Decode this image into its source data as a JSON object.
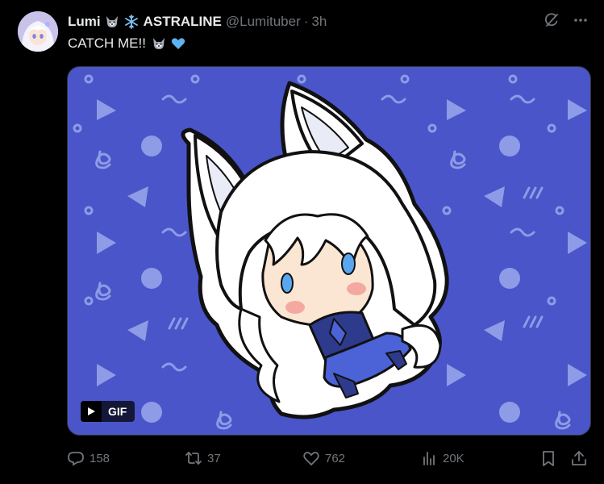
{
  "post": {
    "display_name": "Lumi",
    "display_name_suffix": "ASTRALINE",
    "handle": "@Lumituber",
    "separator": "·",
    "time": "3h",
    "text": "CATCH ME!!",
    "name_icons": [
      "wolf-emoji",
      "snowflake-emoji"
    ],
    "text_icons": [
      "wolf-emoji",
      "blue-heart-emoji"
    ]
  },
  "media": {
    "type": "gif",
    "badge_label": "GIF",
    "background_color": "#4a55c9",
    "pattern_color": "#8e9be6"
  },
  "actions": {
    "replies": "158",
    "reposts": "37",
    "likes": "762",
    "views": "20K"
  },
  "colors": {
    "background": "#000000",
    "text_primary": "#e7e9ea",
    "text_secondary": "#71767b"
  }
}
